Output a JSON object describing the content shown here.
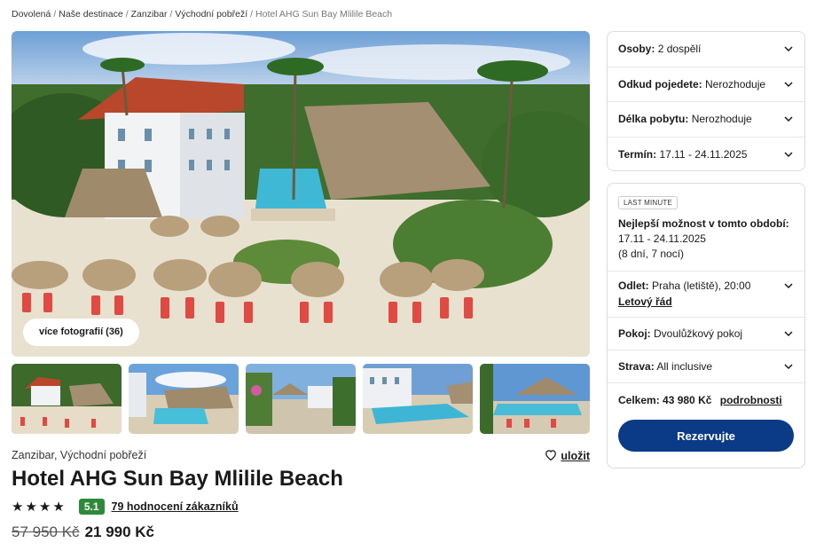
{
  "breadcrumb": {
    "items": [
      "Dovolená",
      "Naše destinace",
      "Zanzibar",
      "Východní pobřeží"
    ],
    "current": "Hotel AHG Sun Bay Mlilile Beach"
  },
  "gallery": {
    "more_photos_label": "více fotografií (36)"
  },
  "hotel": {
    "location": "Zanzibar, Východní pobřeží",
    "save_label": "uložit",
    "name": "Hotel AHG Sun Bay Mlilile Beach",
    "stars": 4,
    "score": "5.1",
    "reviews_label": "79 hodnocení zákazníků",
    "old_price": "57 950 Kč",
    "new_price": "21 990 Kč"
  },
  "search_options": [
    {
      "label": "Osoby:",
      "value": "2 dospělí"
    },
    {
      "label": "Odkud pojedete:",
      "value": "Nerozhoduje"
    },
    {
      "label": "Délka pobytu:",
      "value": "Nerozhoduje"
    },
    {
      "label": "Termín:",
      "value": "17.11 - 24.11.2025"
    }
  ],
  "offer": {
    "badge": "LAST MINUTE",
    "best_title": "Nejlepší možnost v tomto období:",
    "dates": "17.11 - 24.11.2025",
    "duration": "(8 dní, 7 nocí)",
    "departure_label": "Odlet:",
    "departure_value": "Praha (letiště), 20:00",
    "timetable_link": "Letový řád",
    "room_label": "Pokoj:",
    "room_value": "Dvoulůžkový pokoj",
    "board_label": "Strava:",
    "board_value": "All inclusive",
    "total_label": "Celkem:",
    "total_value": "43 980 Kč",
    "details_link": "podrobnosti",
    "reserve_label": "Rezervujte"
  },
  "colors": {
    "primary_button": "#0b3a86",
    "score_badge": "#2e8a3a"
  }
}
